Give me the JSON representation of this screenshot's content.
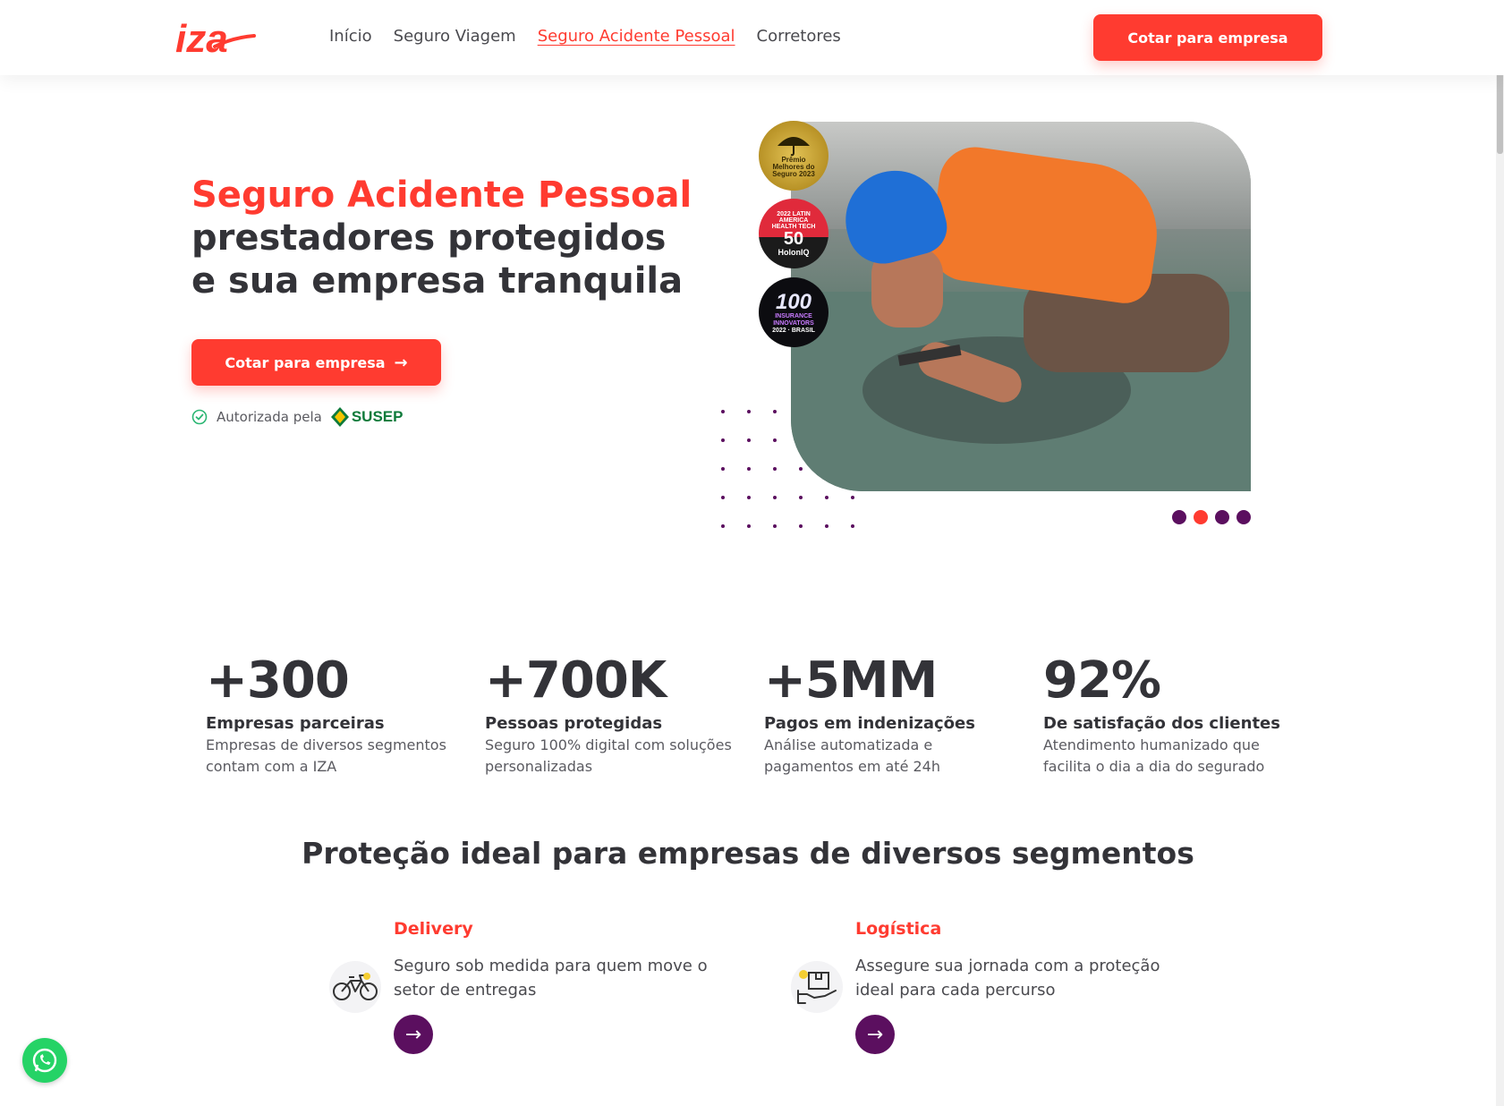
{
  "header": {
    "logo_text": "iza",
    "nav": [
      {
        "label": "Início",
        "active": false
      },
      {
        "label": "Seguro Viagem",
        "active": false
      },
      {
        "label": "Seguro Acidente Pessoal",
        "active": true
      },
      {
        "label": "Corretores",
        "active": false
      }
    ],
    "cta_label": "Cotar para empresa"
  },
  "hero": {
    "title_accent": "Seguro Acidente Pessoal",
    "title_rest": "prestadores protegidos e sua empresa tranquila",
    "cta_label": "Cotar para empresa",
    "auth_text": "Autorizada pela",
    "auth_brand": "SUSEP",
    "badges": {
      "gold": "Prêmio Melhores do Seguro 2023",
      "red_top": "2022 LATIN AMERICA HEALTH TECH",
      "red_big": "50",
      "red_bottom": "HolonIQ",
      "dark_big": "100",
      "dark_mid": "INSURANCE INNOVATORS",
      "dark_bottom": "2022 · BRASIL"
    },
    "carousel_active_index": 1,
    "carousel_count": 4
  },
  "stats": [
    {
      "num": "+300",
      "label": "Empresas parceiras",
      "desc": "Empresas de diversos segmentos contam com a IZA"
    },
    {
      "num": "+700K",
      "label": "Pessoas protegidas",
      "desc": "Seguro 100% digital com soluções personalizadas"
    },
    {
      "num": "+5MM",
      "label": "Pagos em indenizações",
      "desc": "Análise automatizada e pagamentos em até 24h"
    },
    {
      "num": "92%",
      "label": "De satisfação dos clientes",
      "desc": "Atendimento humanizado que facilita o dia a dia do segurado"
    }
  ],
  "segments": {
    "title": "Proteção ideal para empresas de diversos segmentos",
    "items": [
      {
        "name": "Delivery",
        "text": "Seguro sob medida para quem move o setor de entregas",
        "icon": "bicycle-icon"
      },
      {
        "name": "Logística",
        "text": "Assegure sua jornada com a proteção ideal para cada percurso",
        "icon": "package-hand-icon"
      }
    ]
  },
  "colors": {
    "accent": "#ff3b30",
    "purple": "#5b0f5f",
    "text": "#333338",
    "whatsapp": "#25d366"
  }
}
